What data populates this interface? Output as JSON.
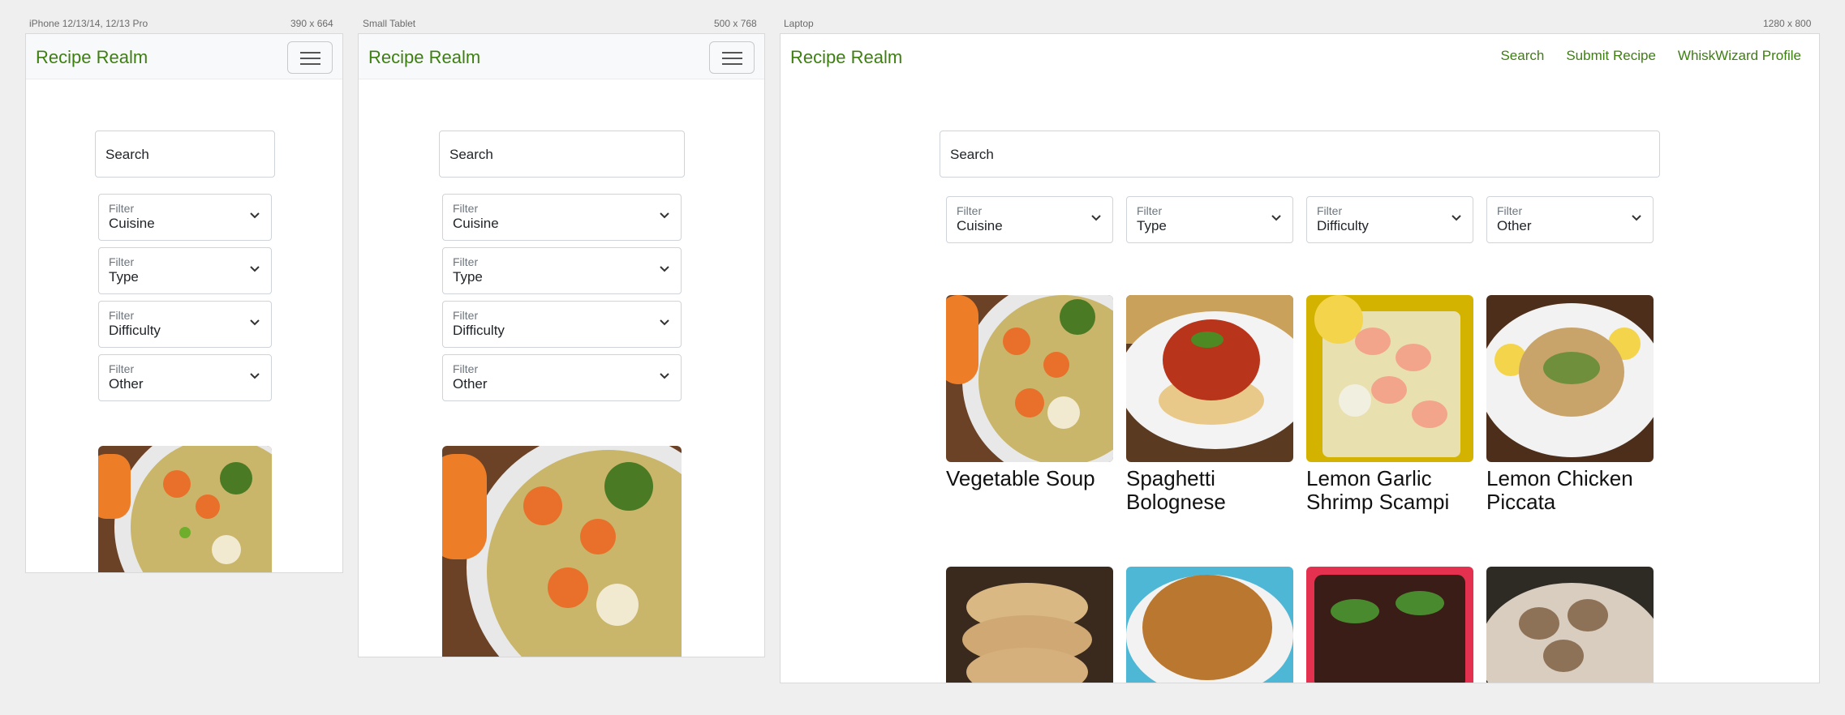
{
  "frames": {
    "phone": {
      "device": "iPhone 12/13/14, 12/13 Pro",
      "size": "390 x 664"
    },
    "tablet": {
      "device": "Small Tablet",
      "size": "500 x 768"
    },
    "laptop": {
      "device": "Laptop",
      "size": "1280 x 800"
    }
  },
  "app": {
    "brand": "Recipe Realm",
    "nav_links": [
      "Search",
      "Submit Recipe",
      "WhiskWizard Profile"
    ],
    "search_placeholder": "Search",
    "filter_label": "Filter",
    "filters": [
      "Cuisine",
      "Type",
      "Difficulty",
      "Other"
    ]
  },
  "recipes": [
    {
      "title": "Vegetable Soup"
    },
    {
      "title": "Spaghetti Bolognese"
    },
    {
      "title": "Lemon Garlic Shrimp Scampi"
    },
    {
      "title": "Lemon Chicken Piccata"
    }
  ],
  "more_recipes": [
    {
      "image": "cookies"
    },
    {
      "image": "noodles"
    },
    {
      "image": "tacos"
    },
    {
      "image": "mushroom-sauce"
    }
  ],
  "colors": {
    "brand": "#3d7f11",
    "page_bg": "#efefef"
  }
}
